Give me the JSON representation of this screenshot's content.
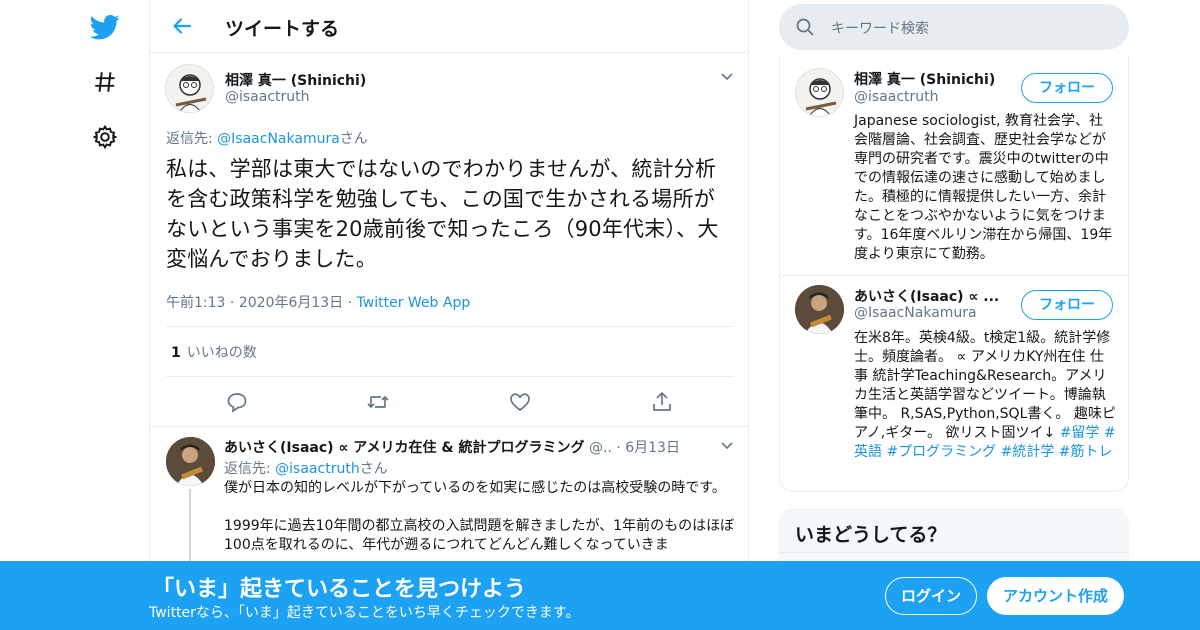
{
  "header": {
    "title": "ツイートする"
  },
  "tweet": {
    "name": "相澤 真一 (Shinichi)",
    "handle": "@isaactruth",
    "reply_prefix": "返信先: ",
    "reply_to": "@IsaacNakamura",
    "reply_suffix": "さん",
    "text": "私は、学部は東大ではないのでわかりませんが、統計分析を含む政策科学を勉強しても、この国で生かされる場所がないという事実を20歳前後で知ったころ（90年代末）、大変悩んでおりました。",
    "time": "午前1:13",
    "date": "2020年6月13日",
    "dot": "·",
    "source": "Twitter Web App",
    "likes_count": "1",
    "likes_label": "いいねの数"
  },
  "reply": {
    "name": "あいさく(Isaac) ∝ アメリカ在住 & 統計プログラミング",
    "handle": "@..",
    "dot": "·",
    "date": "6月13日",
    "reply_prefix": "返信先: ",
    "reply_to": "@isaactruth",
    "reply_suffix": "さん",
    "line1": "僕が日本の知的レベルが下がっているのを如実に感じたのは高校受験の時です。",
    "line2": "1999年に過去10年間の都立高校の入試問題を解きましたが、1年前のものはほぼ100点を取れるのに、年代が遡るにつれてどんどん難しくなっていきま"
  },
  "search": {
    "placeholder": "キーワード検索"
  },
  "profiles": [
    {
      "name": "相澤 真一 (Shinichi)",
      "handle": "@isaactruth",
      "follow": "フォロー",
      "bio": "Japanese sociologist, 教育社会学、社会階層論、社会調査、歴史社会学などが専門の研究者です。震災中のtwitterの中での情報伝達の速さに感動して始めました。積極的に情報提供したい一方、余計なことをつぶやかないように気をつけます。16年度ベルリン滞在から帰国、19年度より東京にて勤務。"
    },
    {
      "name": "あいさく(Isaac) ∝ ...",
      "handle": "@IsaacNakamura",
      "follow": "フォロー",
      "bio": "在米8年。英検4級。t検定1級。統計学修士。頻度論者。 ∝ アメリカKY州在住 仕事 統計学Teaching&Research。アメリカ生活と英語学習などツイート。博論執筆中。 R,SAS,Python,SQL書く。 趣味ピアノ,ギター。 欲リスト固ツイ↓ ",
      "tags": "#留学 #英語 #プログラミング #統計学 #筋トレ"
    }
  ],
  "trends": {
    "title": "いまどうしてる？"
  },
  "banner": {
    "title": "「いま」起きていることを見つけよう",
    "subtitle": "Twitterなら、「いま」起きていることをいち早くチェックできます。",
    "login": "ログイン",
    "signup": "アカウント作成"
  },
  "colors": {
    "brand": "#1da1f2",
    "link": "#1b95e0",
    "muted": "#657786",
    "border": "#e6ecf0"
  },
  "icons": [
    "twitter-bird-icon",
    "hashtag-icon",
    "gear-icon",
    "back-arrow-icon",
    "chevron-down-icon",
    "reply-icon",
    "retweet-icon",
    "heart-icon",
    "share-icon",
    "search-icon"
  ]
}
